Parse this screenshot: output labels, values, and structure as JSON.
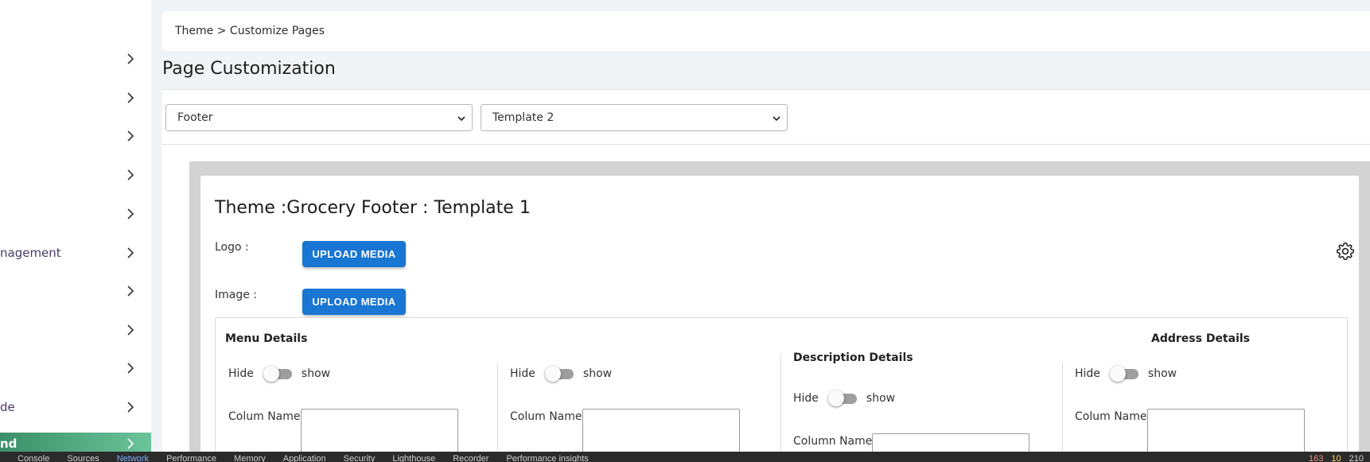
{
  "sidebar": {
    "items": [
      {
        "label": ""
      },
      {
        "label": ""
      },
      {
        "label": ""
      },
      {
        "label": ""
      },
      {
        "label": ""
      },
      {
        "label": "nagement"
      },
      {
        "label": ""
      },
      {
        "label": ""
      },
      {
        "label": ""
      },
      {
        "label": "de"
      },
      {
        "label": "nd"
      }
    ]
  },
  "breadcrumb": {
    "text": "Theme > Customize Pages"
  },
  "page": {
    "title": "Page Customization"
  },
  "selects": {
    "page_type": "Footer",
    "template": "Template 2"
  },
  "card": {
    "title": "Theme :Grocery Footer : Template 1",
    "logo_label": "Logo :",
    "image_label": "Image :",
    "upload_label": "UPLOAD MEDIA"
  },
  "details": {
    "menu": {
      "title": "Menu Details",
      "hide": "Hide",
      "show": "show",
      "field_label": "Colum Name"
    },
    "menu2": {
      "hide": "Hide",
      "show": "show",
      "field_label": "Colum Name"
    },
    "description": {
      "title": "Description Details",
      "hide": "Hide",
      "show": "show",
      "field_label": "Column Name"
    },
    "address": {
      "title": "Address Details",
      "hide": "Hide",
      "show": "show",
      "field_label": "Colum Name"
    }
  },
  "devtools": {
    "tabs": [
      "Console",
      "Sources",
      "Network",
      "Performance",
      "Memory",
      "Application",
      "Security",
      "Lighthouse",
      "Recorder",
      "Performance insights"
    ],
    "errors": "163",
    "warnings": "10",
    "info": "210"
  },
  "colors": {
    "accent": "#1976d2",
    "sidebar_active": "#3b8f6a",
    "background": "#f1f4f6"
  },
  "icons": [
    "chevron-right-icon",
    "chevron-down-icon",
    "gear-icon"
  ]
}
